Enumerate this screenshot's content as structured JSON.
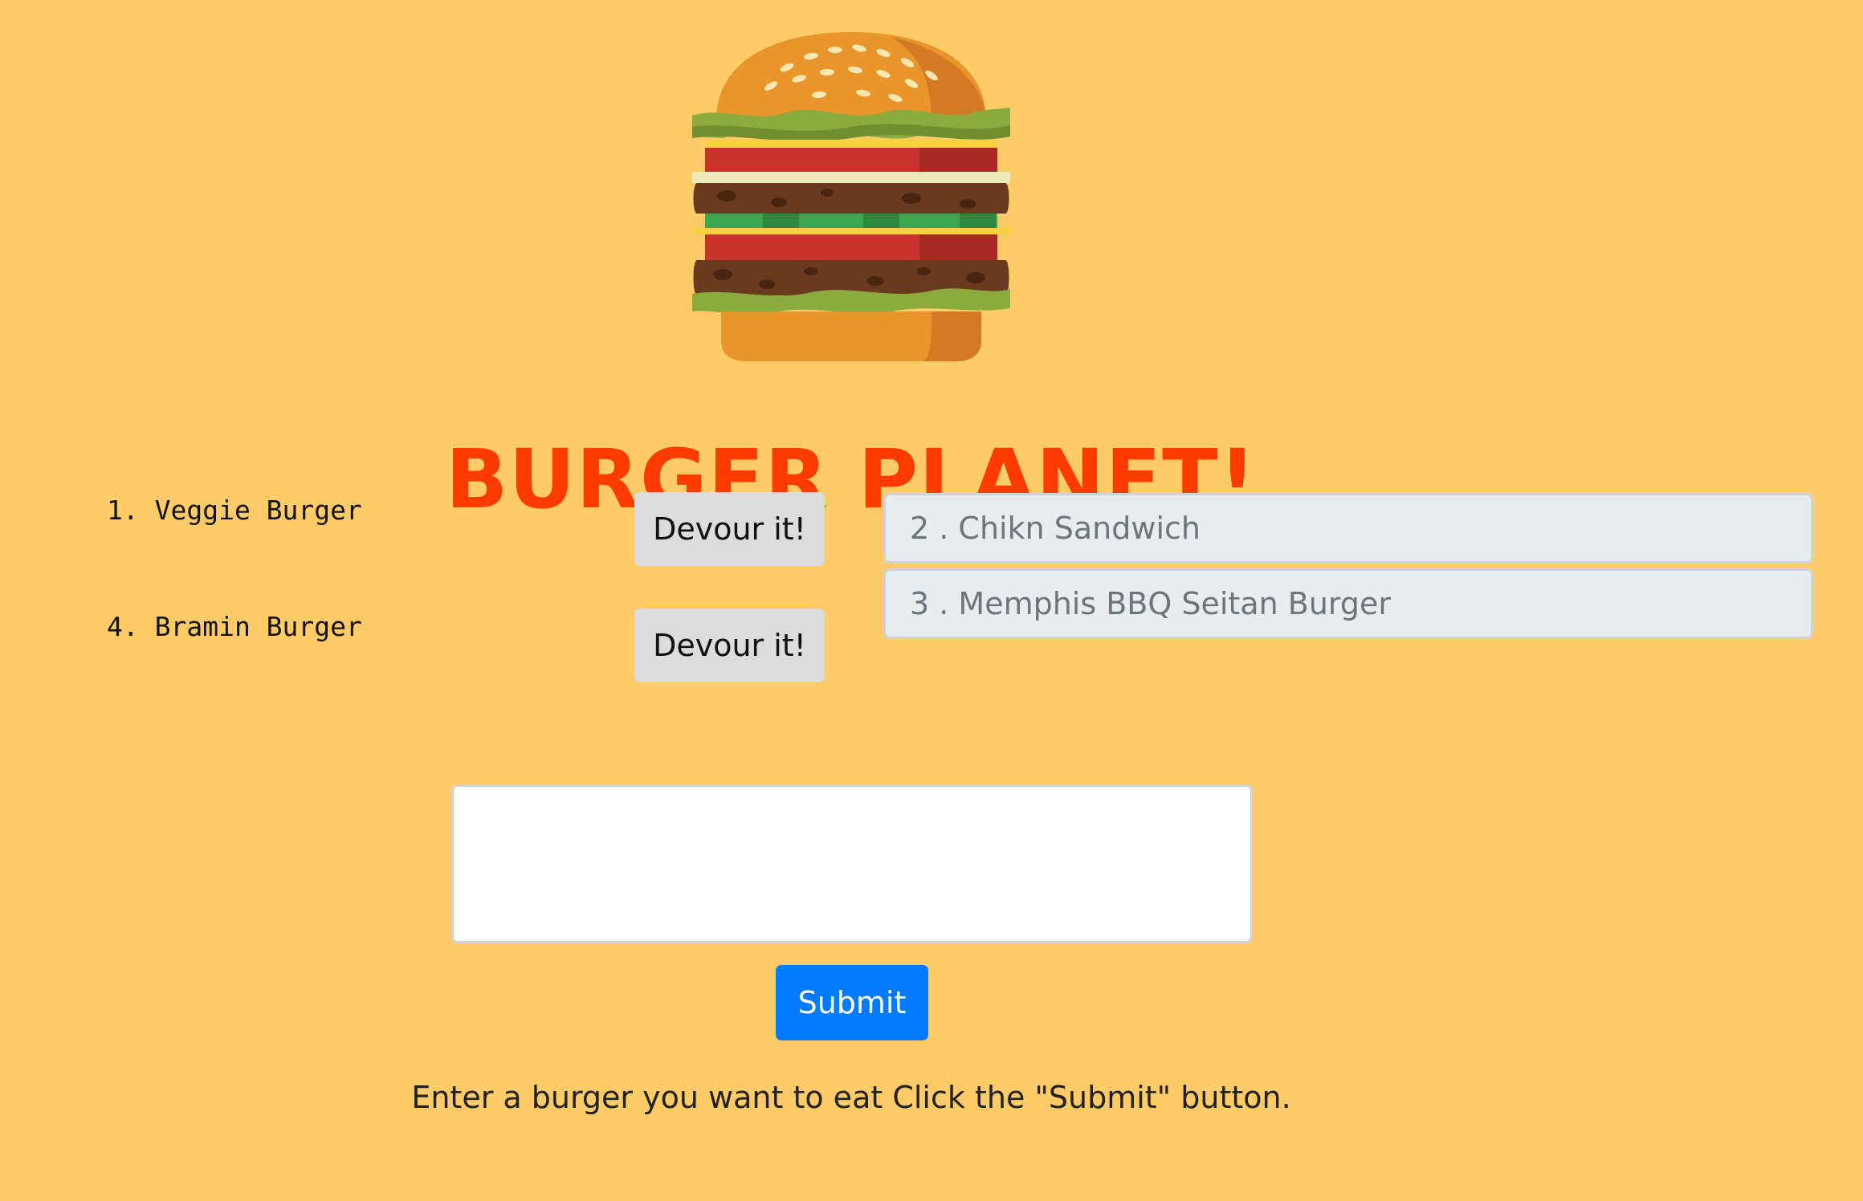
{
  "header": {
    "title": "BURGER PLANET!"
  },
  "logo": {
    "icon": "burger-icon"
  },
  "undevoured": [
    {
      "label": "1. Veggie Burger",
      "button": "Devour it!"
    },
    {
      "label": "4. Bramin Burger",
      "button": "Devour it!"
    }
  ],
  "devoured": [
    {
      "label": "2 . Chikn Sandwich"
    },
    {
      "label": "3 . Memphis BBQ Seitan Burger"
    }
  ],
  "form": {
    "input_value": "",
    "submit_label": "Submit",
    "instructions": "Enter a burger you want to eat Click the \"Submit\" button."
  },
  "colors": {
    "background": "#fecb66",
    "title": "#ff3b00",
    "submit": "#007bff",
    "devour_button": "#dcdcdc",
    "devoured_item": "#e9ecef"
  }
}
